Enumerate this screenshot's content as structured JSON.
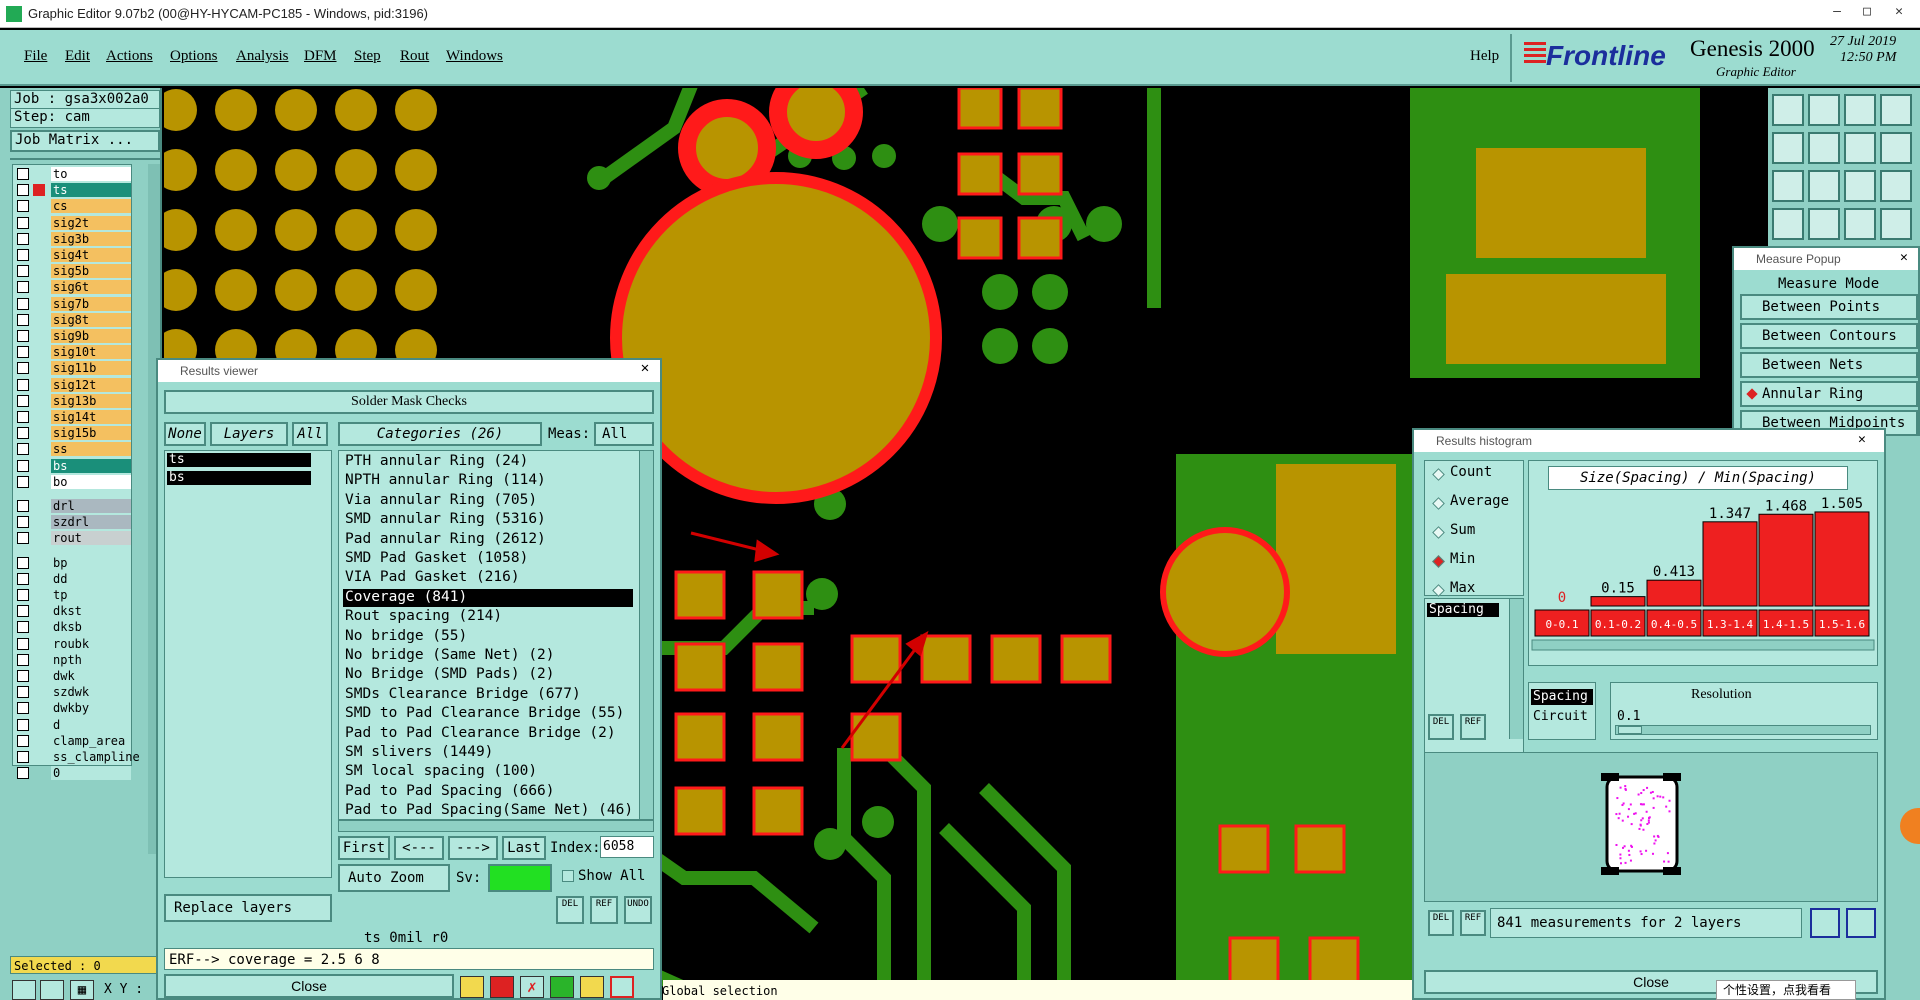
{
  "window": {
    "title": "Graphic Editor 9.07b2 (00@HY-HYCAM-PC185 - Windows, pid:3196)"
  },
  "menu": {
    "items": [
      "File",
      "Edit",
      "Actions",
      "Options",
      "Analysis",
      "DFM",
      "Step",
      "Rout",
      "Windows"
    ],
    "help": "Help"
  },
  "brand": {
    "logo": "Frontline",
    "product": "Genesis 2000",
    "subtitle": "Graphic Editor",
    "date": "27 Jul 2019",
    "time": "12:50 PM"
  },
  "job": {
    "job_label": "Job : gsa3x002a0",
    "step_label": "Step: cam",
    "matrix_button": "Job Matrix ..."
  },
  "layers": [
    {
      "name": "to",
      "color": "#ffffff"
    },
    {
      "name": "ts",
      "color": "#1a8f7a"
    },
    {
      "name": "cs",
      "color": "#f4c060"
    },
    {
      "name": "sig2t",
      "color": "#f4c060"
    },
    {
      "name": "sig3b",
      "color": "#f4c060"
    },
    {
      "name": "sig4t",
      "color": "#f4c060"
    },
    {
      "name": "sig5b",
      "color": "#f4c060"
    },
    {
      "name": "sig6t",
      "color": "#f4c060"
    },
    {
      "name": "sig7b",
      "color": "#f4c060"
    },
    {
      "name": "sig8t",
      "color": "#f4c060"
    },
    {
      "name": "sig9b",
      "color": "#f4c060"
    },
    {
      "name": "sig10t",
      "color": "#f4c060"
    },
    {
      "name": "sig11b",
      "color": "#f4c060"
    },
    {
      "name": "sig12t",
      "color": "#f4c060"
    },
    {
      "name": "sig13b",
      "color": "#f4c060"
    },
    {
      "name": "sig14t",
      "color": "#f4c060"
    },
    {
      "name": "sig15b",
      "color": "#f4c060"
    },
    {
      "name": "ss",
      "color": "#f4c060"
    },
    {
      "name": "bs",
      "color": "#1a8f7a"
    },
    {
      "name": "bo",
      "color": "#ffffff"
    },
    {
      "name": "drl",
      "color": "#aab8c0"
    },
    {
      "name": "szdrl",
      "color": "#aab8c0"
    },
    {
      "name": "rout",
      "color": "#c8d0d0"
    },
    {
      "name": "bp",
      "color": "#b4e8de"
    },
    {
      "name": "dd",
      "color": "#b4e8de"
    },
    {
      "name": "tp",
      "color": "#b4e8de"
    },
    {
      "name": "dkst",
      "color": "#b4e8de"
    },
    {
      "name": "dksb",
      "color": "#b4e8de"
    },
    {
      "name": "roubk",
      "color": "#b4e8de"
    },
    {
      "name": "npth",
      "color": "#b4e8de"
    },
    {
      "name": "dwk",
      "color": "#b4e8de"
    },
    {
      "name": "szdwk",
      "color": "#b4e8de"
    },
    {
      "name": "dwkby",
      "color": "#b4e8de"
    },
    {
      "name": "d",
      "color": "#b4e8de"
    },
    {
      "name": "clamp_area",
      "color": "#b4e8de"
    },
    {
      "name": "ss_clampline",
      "color": "#b4e8de"
    },
    {
      "name": "0",
      "color": "#b4e8de"
    }
  ],
  "status": {
    "selected": "Selected : 0",
    "xy": "X Y :",
    "bottom_msg": "Global selection"
  },
  "results_viewer": {
    "title": "Results viewer",
    "header": "Solder Mask Checks",
    "none_btn": "None",
    "layers_btn": "Layers",
    "all_btn": "All",
    "layer_items": [
      "ts",
      "bs"
    ],
    "categories_btn": "Categories (26)",
    "meas_label": "Meas:",
    "meas_value": "All",
    "categories": [
      "PTH annular Ring (24)",
      "NPTH annular Ring (114)",
      "Via annular Ring (705)",
      "SMD annular Ring (5316)",
      "Pad annular Ring (2612)",
      "SMD Pad Gasket (1058)",
      "VIA Pad Gasket (216)",
      "Coverage (841)",
      "Rout spacing (214)",
      "No bridge (55)",
      "No bridge (Same Net) (2)",
      "No Bridge (SMD Pads) (2)",
      "SMDs Clearance Bridge (677)",
      "SMD to Pad Clearance Bridge (55)",
      "Pad to Pad Clearance Bridge (2)",
      "SM slivers (1449)",
      "SM local spacing (100)",
      "Pad to Pad Spacing (666)",
      "Pad to Pad Spacing(Same Net) (46)"
    ],
    "selected_category": "Coverage (841)",
    "nav": {
      "first": "First",
      "prev": "<---",
      "next": "--->",
      "last": "Last",
      "index_label": "Index:",
      "index_value": "6058"
    },
    "auto_zoom": "Auto Zoom",
    "sv_label": "Sv:",
    "show_all": "Show All",
    "replace_layers": "Replace layers",
    "info_line": "ts 0mil  r0",
    "erf_line": "ERF--> coverage = 2.5 6 8",
    "close": "Close",
    "icon_labels": {
      "del": "DEL",
      "ref": "REF",
      "undo": "UNDO"
    }
  },
  "measure_popup": {
    "title": "Measure Popup",
    "header": "Measure Mode",
    "modes": [
      "Between Points",
      "Between Contours",
      "Between Nets",
      "Annular Ring",
      "Between Midpoints"
    ],
    "selected_mode": "Annular Ring"
  },
  "histogram": {
    "title": "Results histogram",
    "stats": [
      "Count",
      "Average",
      "Sum",
      "Min",
      "Max"
    ],
    "selected_stat": "Min",
    "chart_title": "Size(Spacing) / Min(Spacing)",
    "measure_list": [
      "Spacing"
    ],
    "group_options": [
      "Spacing",
      "Circuit"
    ],
    "resolution_label": "Resolution",
    "resolution_value": "0.1",
    "footer": "841 measurements for 2 layers",
    "close": "Close",
    "icon_labels": {
      "del": "DEL",
      "ref": "REF"
    }
  },
  "chart_data": {
    "type": "bar",
    "title": "Size(Spacing) / Min(Spacing)",
    "categories": [
      "0-0.1",
      "0.1-0.2",
      "0.4-0.5",
      "1.3-1.4",
      "1.4-1.5",
      "1.5-1.6"
    ],
    "values": [
      0,
      0.15,
      0.413,
      1.347,
      1.468,
      1.505
    ],
    "value_labels": [
      "0",
      "0.15",
      "0.413",
      "1.347",
      "1.468",
      "1.505"
    ],
    "ylim": [
      0,
      1.6
    ],
    "bar_color": "#ee2020"
  },
  "tray": {
    "tooltip": "个性设置，点我看看"
  },
  "colors": {
    "copper": "#b89400",
    "mask": "#2e8f12",
    "highlight": "#ff1a1a",
    "panel": "#9cdcd0"
  }
}
